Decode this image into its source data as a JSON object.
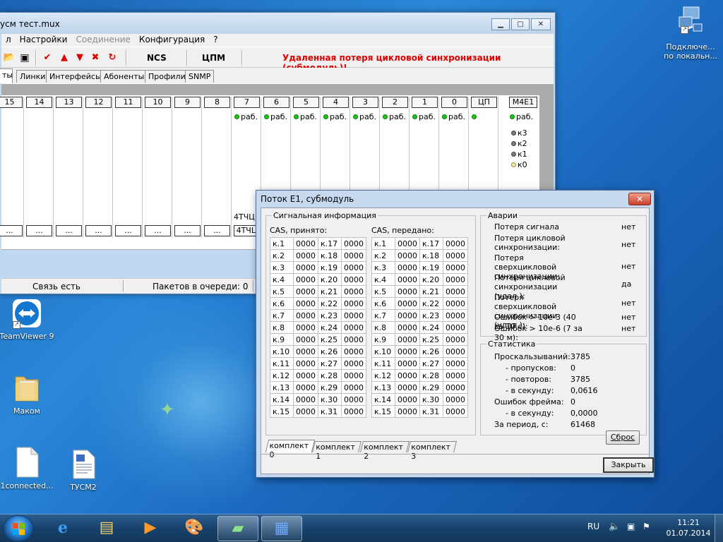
{
  "main_window": {
    "title": "усм тест.mux",
    "menu": [
      "л",
      "Настройки",
      "Соединение",
      "Конфигурация",
      "?"
    ],
    "toolbar": {
      "ncs": "NCS",
      "cpm": "ЦПМ",
      "alarm": "Удаленная потеря цикловой синхронизации (субмодуль)!"
    },
    "tabs": [
      "ты",
      "Линки",
      "Интерфейсы",
      "Абоненты",
      "Профили",
      "SNMP"
    ],
    "slots": [
      {
        "num": "15",
        "status": "",
        "bottom": "..."
      },
      {
        "num": "14",
        "status": "",
        "bottom": "..."
      },
      {
        "num": "13",
        "status": "",
        "bottom": "..."
      },
      {
        "num": "12",
        "status": "",
        "bottom": "..."
      },
      {
        "num": "11",
        "status": "",
        "bottom": "..."
      },
      {
        "num": "10",
        "status": "",
        "bottom": "..."
      },
      {
        "num": "9",
        "status": "",
        "bottom": "..."
      },
      {
        "num": "8",
        "status": "",
        "bottom": "..."
      },
      {
        "num": "7",
        "status": "раб.",
        "bottom": "4ТЧЦ"
      },
      {
        "num": "6",
        "status": "раб.",
        "bottom": ""
      },
      {
        "num": "5",
        "status": "раб.",
        "bottom": ""
      },
      {
        "num": "4",
        "status": "раб.",
        "bottom": ""
      },
      {
        "num": "3",
        "status": "раб.",
        "bottom": ""
      },
      {
        "num": "2",
        "status": "раб.",
        "bottom": ""
      },
      {
        "num": "1",
        "status": "раб.",
        "bottom": ""
      },
      {
        "num": "0",
        "status": "раб.",
        "bottom": ""
      },
      {
        "num": "ЦП",
        "status": "",
        "bottom": ""
      }
    ],
    "slot7_extra": "4ТЧЦ",
    "m4e1": {
      "label": "М4Е1",
      "status": "раб.",
      "k3": "к3",
      "k2": "к2",
      "k1": "к1",
      "k0": "к0"
    },
    "status": {
      "conn": "Связь есть",
      "queue": "Пакетов в очереди: 0"
    }
  },
  "dialog": {
    "title": "Поток E1, субмодуль",
    "signal_group": "Сигнальная информация",
    "cas_rx_label": "CAS, принято:",
    "cas_tx_label": "CAS, передано:",
    "cas_rx": [
      [
        "к.1",
        "0000",
        "к.17",
        "0000"
      ],
      [
        "к.2",
        "0000",
        "к.18",
        "0000"
      ],
      [
        "к.3",
        "0000",
        "к.19",
        "0000"
      ],
      [
        "к.4",
        "0000",
        "к.20",
        "0000"
      ],
      [
        "к.5",
        "0000",
        "к.21",
        "0000"
      ],
      [
        "к.6",
        "0000",
        "к.22",
        "0000"
      ],
      [
        "к.7",
        "0000",
        "к.23",
        "0000"
      ],
      [
        "к.8",
        "0000",
        "к.24",
        "0000"
      ],
      [
        "к.9",
        "0000",
        "к.25",
        "0000"
      ],
      [
        "к.10",
        "0000",
        "к.26",
        "0000"
      ],
      [
        "к.11",
        "0000",
        "к.27",
        "0000"
      ],
      [
        "к.12",
        "0000",
        "к.28",
        "0000"
      ],
      [
        "к.13",
        "0000",
        "к.29",
        "0000"
      ],
      [
        "к.14",
        "0000",
        "к.30",
        "0000"
      ],
      [
        "к.15",
        "0000",
        "к.31",
        "0000"
      ]
    ],
    "cas_tx": [
      [
        "к.1",
        "0000",
        "к.17",
        "0000"
      ],
      [
        "к.2",
        "0000",
        "к.18",
        "0000"
      ],
      [
        "к.3",
        "0000",
        "к.19",
        "0000"
      ],
      [
        "к.4",
        "0000",
        "к.20",
        "0000"
      ],
      [
        "к.5",
        "0000",
        "к.21",
        "0000"
      ],
      [
        "к.6",
        "0000",
        "к.22",
        "0000"
      ],
      [
        "к.7",
        "0000",
        "к.23",
        "0000"
      ],
      [
        "к.8",
        "0000",
        "к.24",
        "0000"
      ],
      [
        "к.9",
        "0000",
        "к.25",
        "0000"
      ],
      [
        "к.10",
        "0000",
        "к.26",
        "0000"
      ],
      [
        "к.11",
        "0000",
        "к.27",
        "0000"
      ],
      [
        "к.12",
        "0000",
        "к.28",
        "0000"
      ],
      [
        "к.13",
        "0000",
        "к.29",
        "0000"
      ],
      [
        "к.14",
        "0000",
        "к.30",
        "0000"
      ],
      [
        "к.15",
        "0000",
        "к.31",
        "0000"
      ]
    ],
    "alarms_group": "Аварии",
    "alarms": [
      {
        "label": "Потеря сигнала",
        "value": "нет"
      },
      {
        "label": "Потеря цикловой синхронизации:",
        "value": "нет"
      },
      {
        "label": "Потеря сверхцикловой синхронизации:",
        "value": "нет"
      },
      {
        "label": "Потеря цикловой синхронизации (удал.):",
        "value": "да"
      },
      {
        "label": "Потеря сверхцикловой синхронизации (удал.):",
        "value": "нет"
      },
      {
        "label": "Ошибок > 10е-3 (40 за 10 с):",
        "value": "нет"
      },
      {
        "label": "Ошибок > 10е-6 (7 за 30 м):",
        "value": "нет"
      }
    ],
    "stats_group": "Статистика",
    "stats": [
      {
        "label": "Проскальзываний:",
        "value": "3785"
      },
      {
        "label": "- пропусков:",
        "value": "0"
      },
      {
        "label": "- повторов:",
        "value": "3785"
      },
      {
        "label": "- в секунду:",
        "value": "0,0616"
      },
      {
        "label": "Ошибок фрейма:",
        "value": "0"
      },
      {
        "label": "- в секунду:",
        "value": "0,0000"
      },
      {
        "label": "За период, с:",
        "value": "61468"
      }
    ],
    "reset_label": "Сброс",
    "tabs": [
      "комплект 0",
      "комплект 1",
      "комплект 2",
      "комплект 3"
    ],
    "close_label": "Закрыть"
  },
  "desktop": {
    "icons": [
      {
        "label": "Подключе... по локальн..."
      },
      {
        "label": "TeamViewer 9"
      },
      {
        "label": "Маком"
      },
      {
        "label": "1connected..."
      },
      {
        "label": "ТУСМ2"
      }
    ]
  },
  "taskbar": {
    "lang": "RU",
    "time": "11:21",
    "date": "01.07.2014"
  }
}
